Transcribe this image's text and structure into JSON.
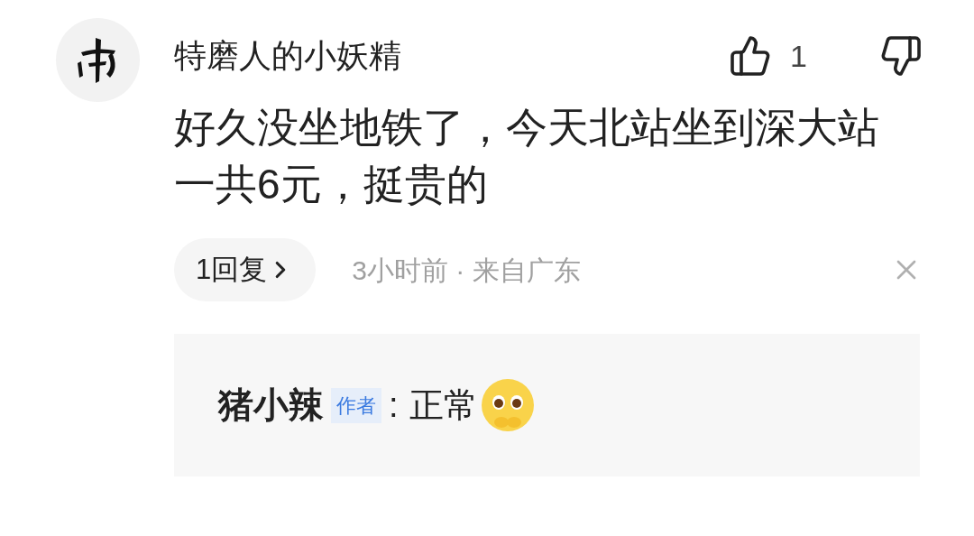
{
  "comment": {
    "author": "特磨人的小妖精",
    "likes": "1",
    "text": "好久没坐地铁了，今天北站坐到深大站一共6元，挺贵的",
    "replies_button": "1回复",
    "meta": "3小时前 · 来自广东"
  },
  "reply": {
    "author": "猪小辣",
    "tag": "作者",
    "separator": ":",
    "text": "正常"
  }
}
